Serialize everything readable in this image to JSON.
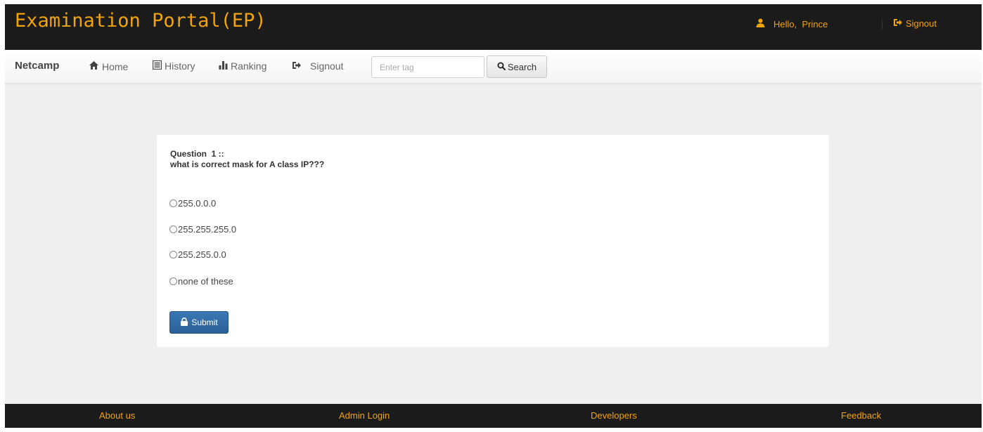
{
  "header": {
    "title": "Examination Portal(EP)",
    "greeting": "Hello,  Prince",
    "signout_label": "Signout",
    "accent_color": "#f0a30a",
    "user_icon": "user-icon",
    "signout_icon": "sign-out-icon"
  },
  "navbar": {
    "brand": "Netcamp",
    "items": [
      {
        "label": "Home",
        "icon": "home-icon"
      },
      {
        "label": "History",
        "icon": "list-icon"
      },
      {
        "label": "Ranking",
        "icon": "bar-chart-icon"
      },
      {
        "label": "Signout",
        "icon": "sign-out-icon"
      }
    ],
    "search": {
      "placeholder": "Enter tag",
      "value": "",
      "button_label": "Search",
      "button_icon": "search-icon"
    }
  },
  "question": {
    "heading": "Question  1 ::",
    "text": "what is correct mask for A class IP???",
    "options": [
      "255.0.0.0",
      "255.255.255.0",
      "255.255.0.0",
      "none of these"
    ],
    "submit_label": "Submit",
    "submit_icon": "lock-icon",
    "submit_color": "#2f6aa6"
  },
  "footer": {
    "links": [
      "About us",
      "Admin Login",
      "Developers",
      "Feedback"
    ]
  }
}
